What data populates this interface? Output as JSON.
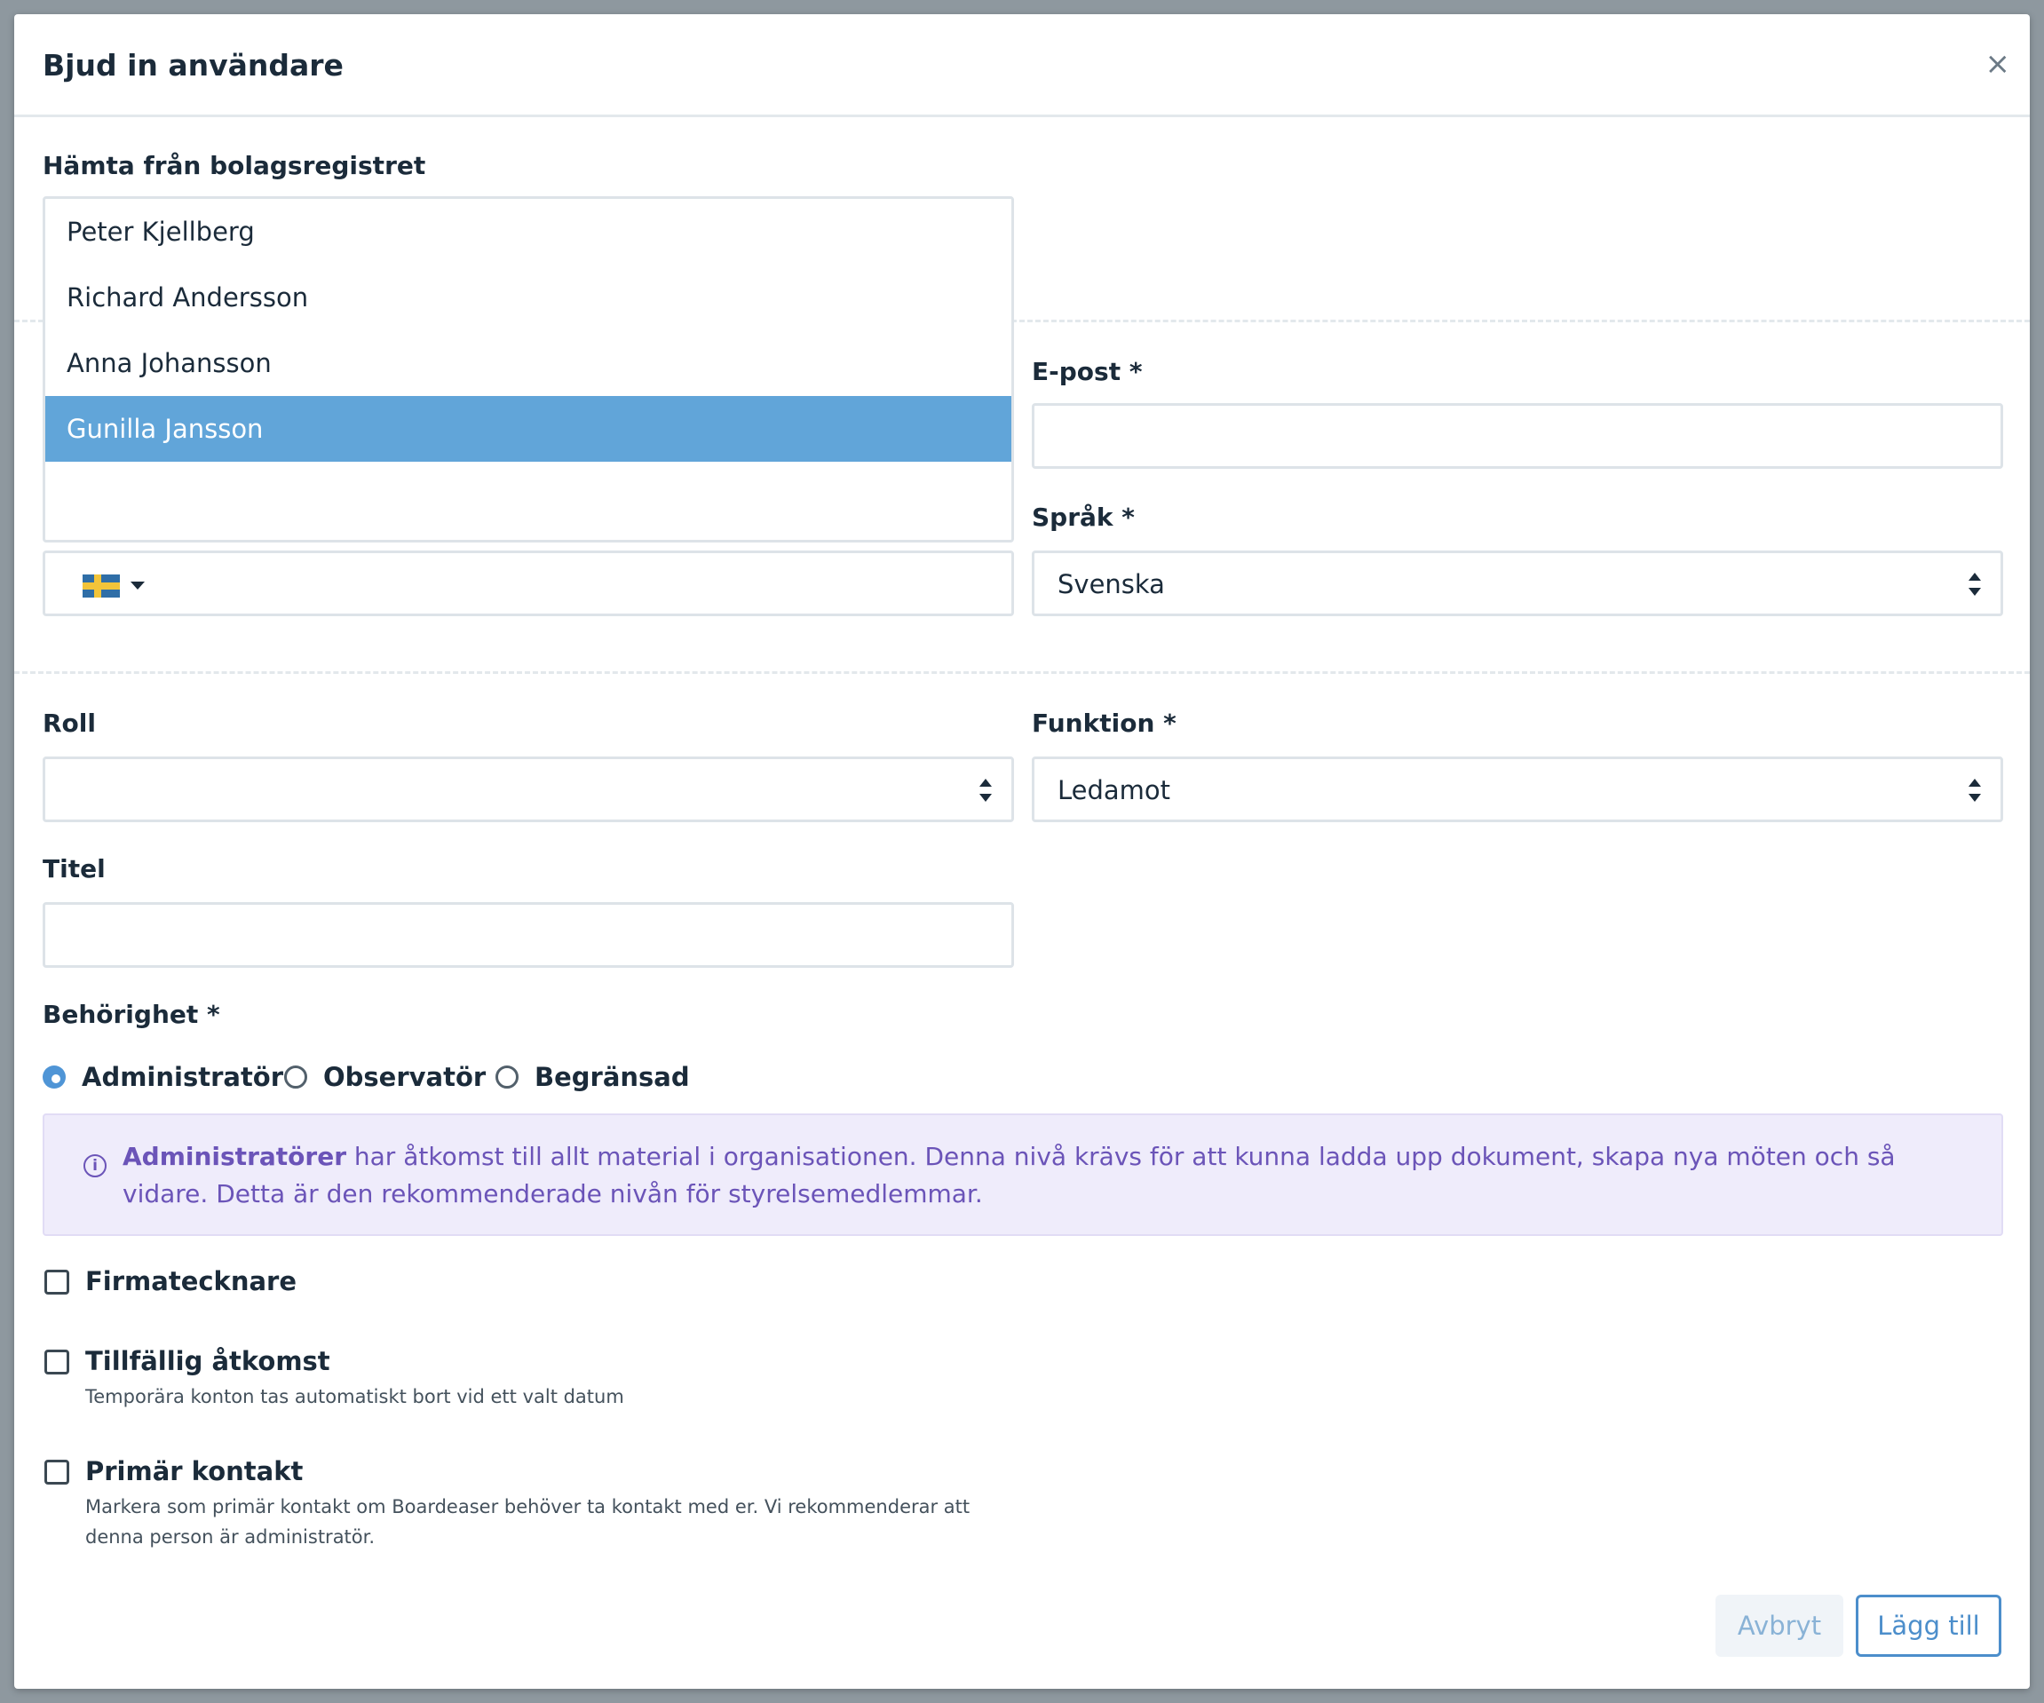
{
  "dialog": {
    "title": "Bjud in användare",
    "close_label": "×"
  },
  "registry": {
    "label": "Hämta från bolagsregistret",
    "value": "",
    "options": [
      "Peter Kjellberg",
      "Richard Andersson",
      "Anna Johansson",
      "Gunilla Jansson"
    ],
    "highlighted": "Gunilla Jansson"
  },
  "email": {
    "label": "E-post *",
    "value": ""
  },
  "phone": {
    "country_flag": "sweden-flag-icon",
    "value": ""
  },
  "language": {
    "label": "Språk *",
    "value": "Svenska"
  },
  "role": {
    "label": "Roll",
    "value": ""
  },
  "function": {
    "label": "Funktion *",
    "value": "Ledamot"
  },
  "title_field": {
    "label": "Titel",
    "value": ""
  },
  "permission": {
    "label": "Behörighet *",
    "options": [
      "Administratör",
      "Observatör",
      "Begränsad"
    ],
    "selected": "Administratör"
  },
  "info": {
    "icon": "info-icon",
    "bold_text": "Administratörer",
    "text": " har åtkomst till allt material i organisationen. Denna nivå krävs för att kunna ladda upp dokument, skapa nya möten och så vidare. Detta är den rekommenderade nivån för styrelsemedlemmar.",
    "color": "#6b54b8",
    "background": "#efecfb"
  },
  "checkboxes": {
    "signatory": {
      "label": "Firmatecknare",
      "checked": false
    },
    "temporary": {
      "label": "Tillfällig åtkomst",
      "help": "Temporära konton tas automatiskt bort vid ett valt datum",
      "checked": false
    },
    "primary": {
      "label": "Primär kontakt",
      "help": "Markera som primär kontakt om Boardeaser behöver ta kontakt med er. Vi rekommenderar att denna person är administratör.",
      "checked": false
    }
  },
  "buttons": {
    "cancel": "Avbryt",
    "add": "Lägg till"
  },
  "colors": {
    "accent": "#4c8ecb",
    "highlight": "#61a5d9"
  }
}
